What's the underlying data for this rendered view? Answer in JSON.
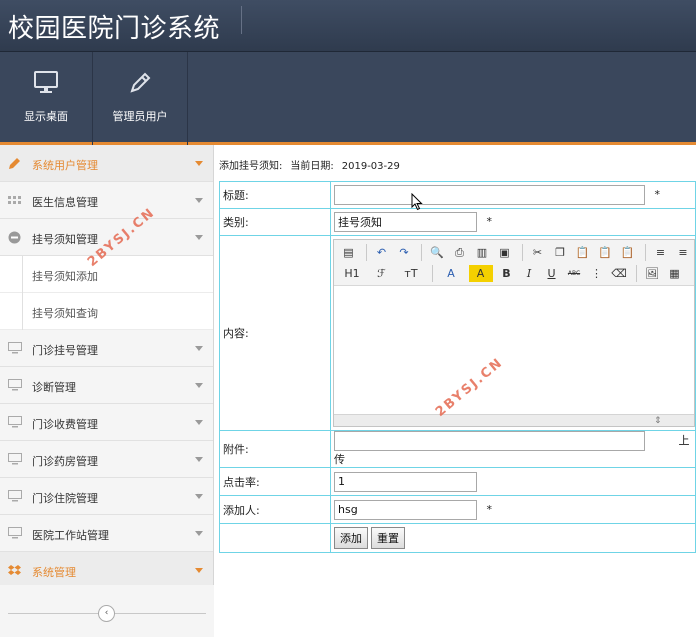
{
  "header": {
    "title": "校园医院门诊系统"
  },
  "toolbar": {
    "desktop_label": "显示桌面",
    "admin_label": "管理员用户"
  },
  "sidebar": {
    "items": [
      {
        "label": "系统用户管理",
        "icon": "pencil-icon"
      },
      {
        "label": "医生信息管理",
        "icon": "grid-icon"
      },
      {
        "label": "挂号须知管理",
        "icon": "minus-circle-icon"
      },
      {
        "label": "门诊挂号管理",
        "icon": "monitor-icon"
      },
      {
        "label": "诊断管理",
        "icon": "monitor-icon"
      },
      {
        "label": "门诊收费管理",
        "icon": "monitor-icon"
      },
      {
        "label": "门诊药房管理",
        "icon": "monitor-icon"
      },
      {
        "label": "门诊住院管理",
        "icon": "monitor-icon"
      },
      {
        "label": "医院工作站管理",
        "icon": "monitor-icon"
      },
      {
        "label": "系统管理",
        "icon": "dropbox-icon"
      }
    ],
    "subitems": [
      {
        "label": "挂号须知添加"
      },
      {
        "label": "挂号须知查询"
      }
    ],
    "collapse_glyph": "‹"
  },
  "main": {
    "breadcrumb": {
      "page": "添加挂号须知:",
      "date_label": "当前日期:",
      "date": "2019-03-29"
    },
    "form": {
      "title_label": "标题:",
      "title_value": "",
      "category_label": "类别:",
      "category_value": "挂号须知",
      "content_label": "内容:",
      "attachment_label": "附件:",
      "attachment_value": "",
      "upload_label": "上传",
      "clicks_label": "点击率:",
      "clicks_value": "1",
      "adder_label": "添加人:",
      "adder_value": "hsg",
      "required_mark": "*",
      "submit_label": "添加",
      "reset_label": "重置"
    },
    "editor": {
      "heading_btn": "H1",
      "font_btn": "ℱ",
      "size_btn": "тT",
      "font_color_btn": "A",
      "highlight_btn": "A",
      "bold_btn": "B",
      "italic_btn": "I",
      "underline_btn": "U",
      "strike_btn": "ABC"
    }
  },
  "watermark": {
    "text": "2BYSJ.CN"
  },
  "colors": {
    "accent": "#e58a32",
    "header_bg": "#3a475c",
    "table_border": "#6fd4e6"
  }
}
